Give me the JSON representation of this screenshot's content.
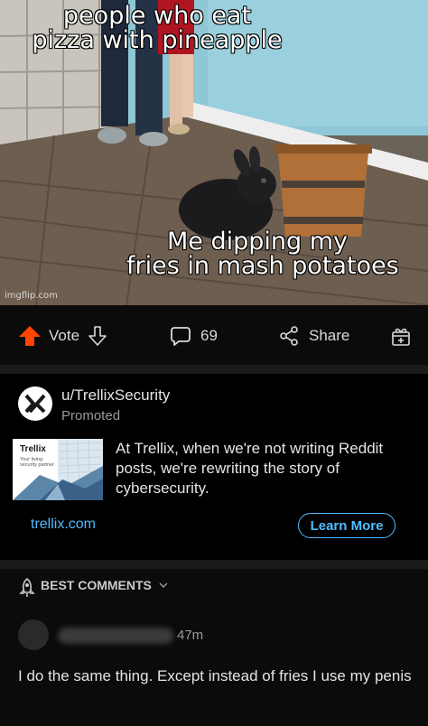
{
  "meme": {
    "top_caption": "people who eat pizza with pineapple",
    "top_caption_lines": [
      "people who eat",
      "pizza with pineapple"
    ],
    "bottom_caption_lines": [
      "Me dipping my",
      "fries in mash potatoes"
    ],
    "watermark": "imgflip.com"
  },
  "actions": {
    "vote_label": "Vote",
    "comment_count": "69",
    "share_label": "Share"
  },
  "promoted": {
    "username": "u/TrellixSecurity",
    "tag": "Promoted",
    "thumb_brand": "Trellix",
    "thumb_tagline": "Your living security partner",
    "body": "At Trellix, when we're not writing Reddit posts, we're rewriting the story of cybersecurity.",
    "link": "trellix.com",
    "cta": "Learn More"
  },
  "comments": {
    "sort_label": "BEST COMMENTS",
    "items": [
      {
        "time": "47m",
        "body": "I do the same thing. Except instead of fries I use my penis"
      }
    ]
  },
  "colors": {
    "upvote": "#ff4500",
    "link": "#4fbcff",
    "background": "#000000",
    "bar": "#0b0b0b"
  }
}
